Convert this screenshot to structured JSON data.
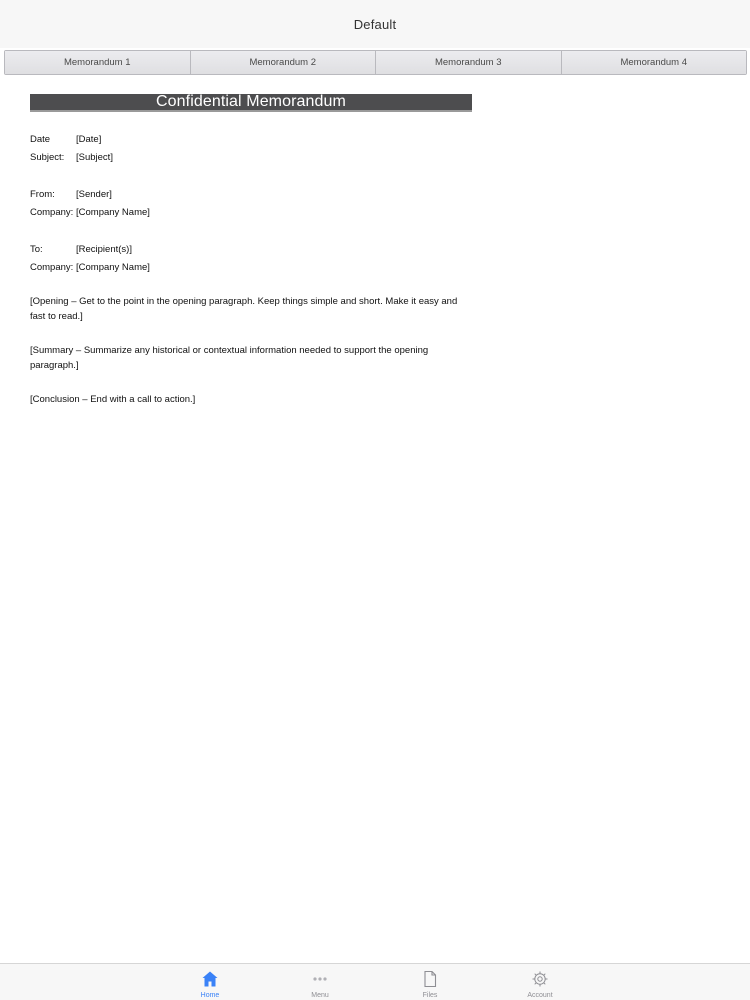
{
  "nav": {
    "title": "Default"
  },
  "segments": [
    {
      "label": "Memorandum 1"
    },
    {
      "label": "Memorandum 2"
    },
    {
      "label": "Memorandum 3"
    },
    {
      "label": "Memorandum 4"
    }
  ],
  "document": {
    "banner": "Confidential Memorandum",
    "header_block": [
      {
        "label": "Date",
        "value": "[Date]"
      },
      {
        "label": "Subject:",
        "value": "[Subject]"
      }
    ],
    "from_block": [
      {
        "label": "From:",
        "value": "[Sender]"
      },
      {
        "label": "Company:",
        "value": "[Company Name]"
      }
    ],
    "to_block": [
      {
        "label": "To:",
        "value": "[Recipient(s)]"
      },
      {
        "label": "Company:",
        "value": "[Company Name]"
      }
    ],
    "paragraphs": [
      "[Opening – Get to the point in the opening paragraph. Keep things simple and short. Make it easy and fast to read.]",
      "[Summary – Summarize any historical or contextual information needed to support the opening paragraph.]",
      "[Conclusion – End with a call to action.]"
    ]
  },
  "tabbar": {
    "items": [
      {
        "label": "Home",
        "icon": "home-icon",
        "active": true
      },
      {
        "label": "Menu",
        "icon": "more-dots-icon",
        "active": false
      },
      {
        "label": "Files",
        "icon": "file-icon",
        "active": false
      },
      {
        "label": "Account",
        "icon": "gear-icon",
        "active": false
      }
    ],
    "active_color": "#3a82f7",
    "inactive_color": "#8e8e93"
  }
}
